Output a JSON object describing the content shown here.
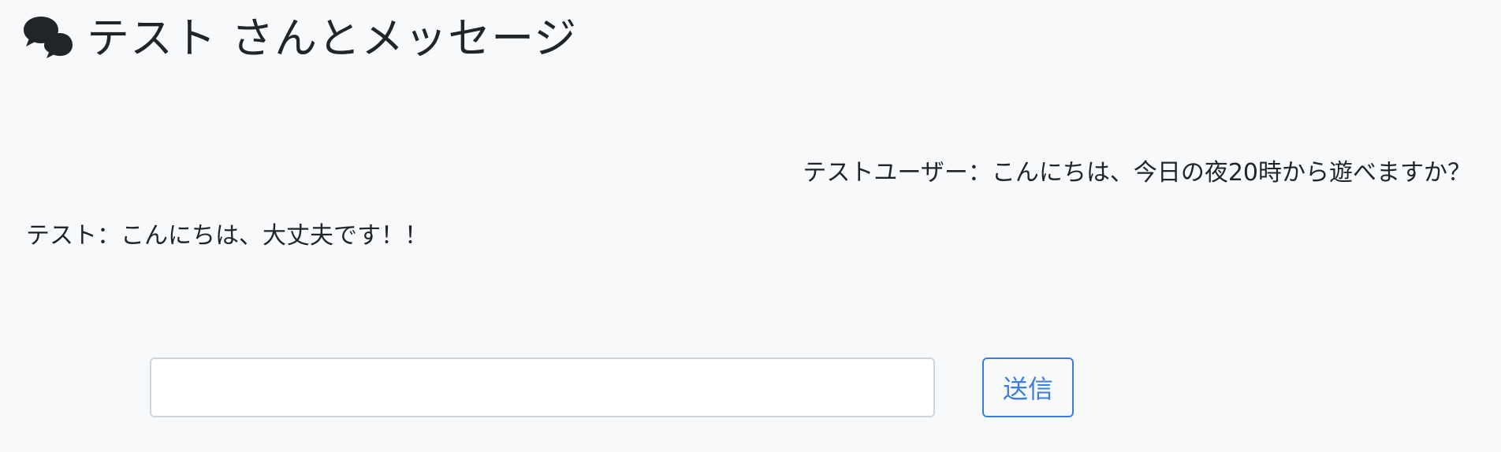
{
  "header": {
    "title": "テスト さんとメッセージ",
    "icon": "comments-icon"
  },
  "messages": [
    {
      "text": "テストユーザー：こんにちは、今日の夜20時から遊べますか？",
      "align": "right"
    },
    {
      "text": "テスト：こんにちは、大丈夫です！！",
      "align": "left"
    }
  ],
  "compose": {
    "input_value": "",
    "placeholder": "",
    "send_label": "送信"
  },
  "colors": {
    "background": "#f8f9fa",
    "text": "#212529",
    "accent": "#3b7ddd",
    "input_border": "#ced4da"
  }
}
